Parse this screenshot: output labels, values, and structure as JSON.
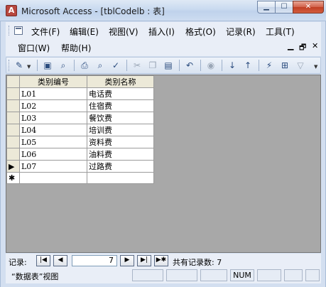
{
  "window": {
    "title": "Microsoft Access - [tblCodelb : 表]",
    "app_icon": "access-icon",
    "minimize_label": "▁",
    "maximize_label": "☐",
    "close_label": "✕"
  },
  "menu": {
    "items": [
      "文件(F)",
      "编辑(E)",
      "视图(V)",
      "插入(I)",
      "格式(O)",
      "记录(R)",
      "工具(T)",
      "窗口(W)",
      "帮助(H)"
    ],
    "doc_controls": [
      "▁",
      "🗗",
      "✕"
    ]
  },
  "toolbar": {
    "icons": [
      "design-view-icon",
      "save-icon",
      "search-icon",
      "print-icon",
      "print-preview-icon",
      "spelling-icon",
      "cut-icon",
      "copy-icon",
      "paste-icon",
      "undo-icon",
      "insert-hyperlink-icon",
      "sort-ascending-icon",
      "sort-descending-icon",
      "filter-by-selection-icon",
      "filter-by-form-icon",
      "apply-filter-icon"
    ]
  },
  "table": {
    "columns": [
      "类别编号",
      "类别名称"
    ],
    "rows": [
      {
        "code": "L01",
        "name": "电话费"
      },
      {
        "code": "L02",
        "name": "住宿费"
      },
      {
        "code": "L03",
        "name": "餐饮费"
      },
      {
        "code": "L04",
        "name": "培训费"
      },
      {
        "code": "L05",
        "name": "资料费"
      },
      {
        "code": "L06",
        "name": "油料费"
      },
      {
        "code": "L07",
        "name": "过路费"
      }
    ],
    "current_row_marker": "▶",
    "new_row_marker": "✱"
  },
  "navigation": {
    "label": "记录:",
    "current_record": "7",
    "total_text": "共有记录数: 7",
    "first": "|◀",
    "prev": "◀",
    "next": "▶",
    "last": "▶|",
    "new": "▶✱"
  },
  "status": {
    "view_text": "“数据表”视图",
    "num_indicator": "NUM"
  },
  "colors": {
    "title_gradient": "#c9daf0",
    "close_button": "#c03f24",
    "sheet_background": "#a8a8a8",
    "header_background": "#ece9d8"
  }
}
